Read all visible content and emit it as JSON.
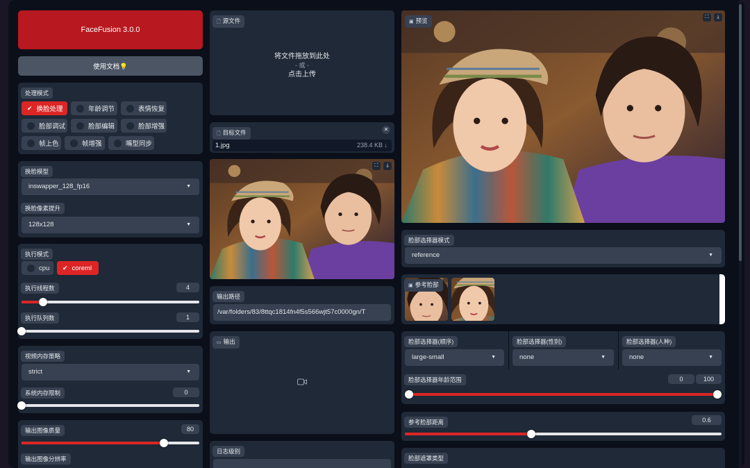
{
  "app": {
    "title": "FaceFusion 3.0.0",
    "docs_label": "使用文档💡"
  },
  "processors": {
    "label": "处理模式",
    "items": [
      {
        "label": "换脸处理",
        "checked": true
      },
      {
        "label": "年龄调节",
        "checked": false
      },
      {
        "label": "表情恢复",
        "checked": false
      },
      {
        "label": "脸部调试",
        "checked": false
      },
      {
        "label": "脸部编辑",
        "checked": false
      },
      {
        "label": "脸部增强",
        "checked": false
      },
      {
        "label": "帧上色",
        "checked": false
      },
      {
        "label": "帧增强",
        "checked": false
      },
      {
        "label": "嘴型同步",
        "checked": false
      }
    ]
  },
  "face_swapper": {
    "model_label": "换脸模型",
    "model_value": "inswapper_128_fp16",
    "pixel_boost_label": "换脸像素提升",
    "pixel_boost_value": "128x128"
  },
  "execution": {
    "label": "执行模式",
    "providers": [
      {
        "label": "cpu",
        "checked": false
      },
      {
        "label": "coreml",
        "checked": true
      }
    ],
    "thread_label": "执行线程数",
    "thread_value": "4",
    "thread_fraction": 0.12,
    "queue_label": "执行队列数",
    "queue_value": "1",
    "queue_fraction": 0.0
  },
  "memory": {
    "strategy_label": "视频内存策略",
    "strategy_value": "strict",
    "limit_label": "系统内存限制",
    "limit_value": "0",
    "limit_fraction": 0.0
  },
  "output_options": {
    "quality_label": "输出图像质量",
    "quality_value": "80",
    "quality_fraction": 0.8,
    "resolution_label": "输出图像分辨率"
  },
  "source": {
    "label": "源文件",
    "drop_text": "将文件拖放到此处",
    "or_text": "- 或 -",
    "click_text": "点击上传"
  },
  "target": {
    "label": "目标文件",
    "file_name": "1.jpg",
    "file_size": "238.4 KB ↓"
  },
  "output_path": {
    "label": "输出路径",
    "value": "/var/folders/83/8ttqc1814fn4f5s566wjt57c0000gn/T"
  },
  "output": {
    "label": "输出"
  },
  "log_level": {
    "label": "日志级别"
  },
  "preview": {
    "label": "预览"
  },
  "face_selector": {
    "mode_label": "脸部选择器模式",
    "mode_value": "reference",
    "reference_label": "参考脸部",
    "order_label": "脸部选择器(顺序)",
    "order_value": "large-small",
    "gender_label": "脸部选择器(性别)",
    "gender_value": "none",
    "race_label": "脸部选择器(人种)",
    "race_value": "none",
    "age_label": "脸部选择器年龄范围",
    "age_min": "0",
    "age_max": "100",
    "distance_label": "参考脸部距离",
    "distance_value": "0.6",
    "distance_fraction": 0.4,
    "mask_label": "脸部遮罩类型"
  },
  "colors": {
    "accent": "#dc2626",
    "panel": "#1f2937",
    "background": "#0b0f19",
    "title_button": "#b8181f"
  }
}
